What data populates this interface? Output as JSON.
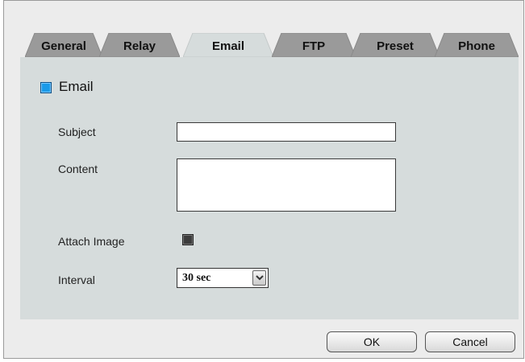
{
  "tabs": [
    {
      "label": "General",
      "active": false
    },
    {
      "label": "Relay",
      "active": false
    },
    {
      "label": "Email",
      "active": true
    },
    {
      "label": "FTP",
      "active": false
    },
    {
      "label": "Preset",
      "active": false
    },
    {
      "label": "Phone",
      "active": false
    }
  ],
  "section": {
    "title": "Email",
    "enabled": true
  },
  "form": {
    "subject_label": "Subject",
    "subject_value": "",
    "content_label": "Content",
    "content_value": "",
    "attach_label": "Attach Image",
    "attach_checked": false,
    "interval_label": "Interval",
    "interval_value": "30 sec"
  },
  "buttons": {
    "ok": "OK",
    "cancel": "Cancel"
  },
  "colors": {
    "panel": "#d6dcdc",
    "active_tab": "#d6dcdc",
    "inactive_tab": "#9a9a9a",
    "checkbox_on": "#1a9ae8"
  }
}
